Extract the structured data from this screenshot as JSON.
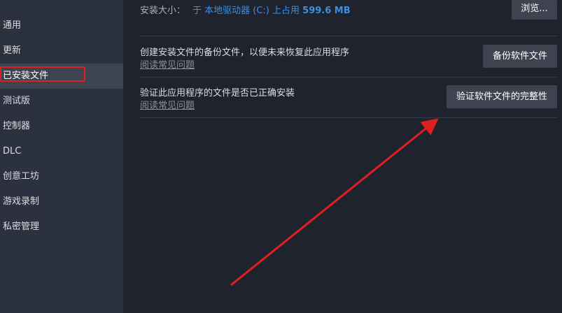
{
  "sidebar": {
    "items": [
      {
        "label": "通用"
      },
      {
        "label": "更新"
      },
      {
        "label": "已安装文件"
      },
      {
        "label": "测试版"
      },
      {
        "label": "控制器"
      },
      {
        "label": "DLC"
      },
      {
        "label": "创意工坊"
      },
      {
        "label": "游戏录制"
      },
      {
        "label": "私密管理"
      }
    ]
  },
  "install_size": {
    "label": "安装大小：",
    "location": "于 本地驱动器 (C:) 上占用",
    "amount": "599.6 MB",
    "browse_label": "浏览..."
  },
  "options": [
    {
      "title": "创建安装文件的备份文件，以便未来恢复此应用程序",
      "link": "阅读常见问题",
      "button": "备份软件文件"
    },
    {
      "title": "验证此应用程序的文件是否已正确安装",
      "link": "阅读常见问题",
      "button": "验证软件文件的完整性"
    }
  ],
  "colors": {
    "sidebar_bg": "#2c3140",
    "content_bg": "#1f232d",
    "button_bg": "#3d4450",
    "accent_blue": "#3d8fe0",
    "annotation_red": "#e01f1f"
  }
}
